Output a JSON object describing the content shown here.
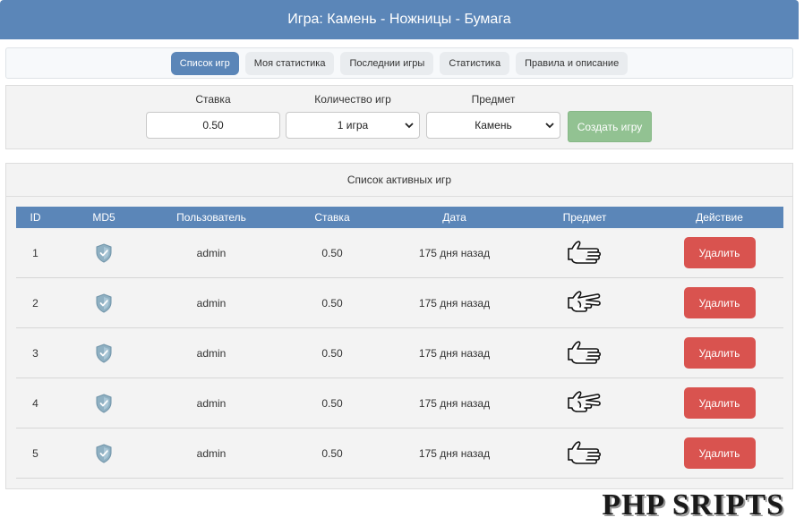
{
  "header": {
    "title": "Игра: Камень - Ножницы - Бумага"
  },
  "nav": {
    "tabs": [
      {
        "label": "Список игр",
        "active": true
      },
      {
        "label": "Моя статистика",
        "active": false
      },
      {
        "label": "Последнии игры",
        "active": false
      },
      {
        "label": "Статистика",
        "active": false
      },
      {
        "label": "Правила и описание",
        "active": false
      }
    ]
  },
  "form": {
    "stake_label": "Ставка",
    "stake_value": "0.50",
    "count_label": "Количество игр",
    "count_value": "1 игра",
    "item_label": "Предмет",
    "item_value": "Камень",
    "create_label": "Создать игру"
  },
  "games": {
    "title": "Список активных игр",
    "columns": [
      "ID",
      "MD5",
      "Пользователь",
      "Ставка",
      "Дата",
      "Предмет",
      "Действие"
    ],
    "rows": [
      {
        "id": "1",
        "md5_icon": "shield-check-icon",
        "user": "admin",
        "stake": "0.50",
        "date": "175 дня назад",
        "item_icon": "paper-hand-icon",
        "action": "Удалить"
      },
      {
        "id": "2",
        "md5_icon": "shield-check-icon",
        "user": "admin",
        "stake": "0.50",
        "date": "175 дня назад",
        "item_icon": "scissors-hand-icon",
        "action": "Удалить"
      },
      {
        "id": "3",
        "md5_icon": "shield-check-icon",
        "user": "admin",
        "stake": "0.50",
        "date": "175 дня назад",
        "item_icon": "paper-hand-icon",
        "action": "Удалить"
      },
      {
        "id": "4",
        "md5_icon": "shield-check-icon",
        "user": "admin",
        "stake": "0.50",
        "date": "175 дня назад",
        "item_icon": "scissors-hand-icon",
        "action": "Удалить"
      },
      {
        "id": "5",
        "md5_icon": "shield-check-icon",
        "user": "admin",
        "stake": "0.50",
        "date": "175 дня назад",
        "item_icon": "paper-hand-icon",
        "action": "Удалить"
      }
    ]
  },
  "watermark": "PHP SRIPTS",
  "colors": {
    "primary": "#5b86b8",
    "danger": "#d9534f",
    "success": "#92c292"
  }
}
